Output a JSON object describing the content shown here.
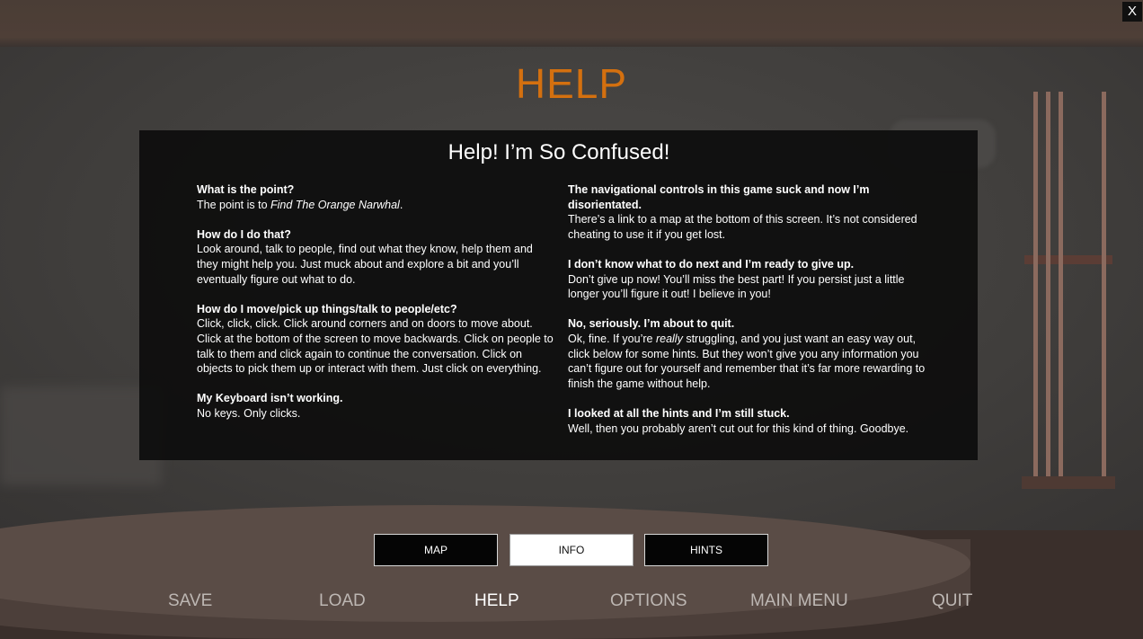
{
  "close_label": "X",
  "title": "HELP",
  "panel": {
    "heading": "Help! I’m So Confused!",
    "left": [
      {
        "q": "What is the point?",
        "a_before": "The point is to ",
        "a_em": "Find The Orange Narwhal",
        "a_after": "."
      },
      {
        "q": "How do I do that?",
        "a": "Look around, talk to people, find out what they know, help them and they might help you. Just muck about and explore a bit and you’ll eventually figure out what to do."
      },
      {
        "q": "How do I move/pick up things/talk to people/etc?",
        "a": "Click, click, click. Click around corners and on doors to move about. Click at the bottom of the screen to move backwards. Click on people to talk to them and click again to continue the conversation. Click on objects to pick them up or interact with them. Just click on everything."
      },
      {
        "q": "My Keyboard isn’t working.",
        "a": "No keys. Only clicks."
      }
    ],
    "right": [
      {
        "q": "The navigational controls in this game suck and now I’m disorientated.",
        "a": "There’s a link to a map at the bottom of this screen. It’s not considered cheating to use it if you get lost."
      },
      {
        "q": "I don’t know what to do next and I’m ready to give up.",
        "a": "Don’t give up now! You’ll miss the best part! If you persist just a little longer you’ll figure it out! I believe in you!"
      },
      {
        "q": "No, seriously. I’m about to quit.",
        "a_before": "Ok, fine. If you’re ",
        "a_em": "really",
        "a_after": " struggling, and you just want an easy way out, click below for some hints. But they won’t give you any information you can’t figure out for yourself and remember that it’s far more rewarding to finish the game without help."
      },
      {
        "q": "I looked at all the hints and I’m still stuck.",
        "a": "Well, then you probably aren’t cut out for this kind of thing. Goodbye."
      }
    ]
  },
  "buttons": {
    "map": "MAP",
    "info": "INFO",
    "hints": "HINTS",
    "active": "INFO"
  },
  "nav": {
    "save": "SAVE",
    "load": "LOAD",
    "help": "HELP",
    "options": "OPTIONS",
    "main_menu": "MAIN MENU",
    "quit": "QUIT",
    "active": "HELP"
  },
  "colors": {
    "title": "#d4700f",
    "panel_bg": "#0e0e0e",
    "nav_inactive": "#bdb7b3",
    "nav_active": "#ffffff"
  }
}
